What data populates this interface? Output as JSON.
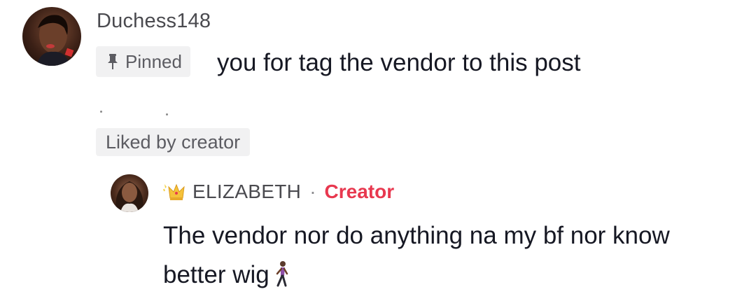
{
  "comment": {
    "username": "Duchess148",
    "pinned_label": "Pinned",
    "text": "you for tag the vendor to this post",
    "liked_label": "Liked by creator"
  },
  "reply": {
    "username": "ELIZABETH",
    "separator": "·",
    "creator_label": "Creator",
    "text": "The vendor nor do anything na my bf nor know better wig"
  },
  "colors": {
    "creator_accent": "#e8384f",
    "text_primary": "#161823",
    "text_secondary": "#4a4a4f",
    "badge_bg": "#f1f1f2"
  },
  "icons": {
    "pin": "pin-icon",
    "crown": "crown-icon",
    "walking_person": "walking-person-icon"
  }
}
